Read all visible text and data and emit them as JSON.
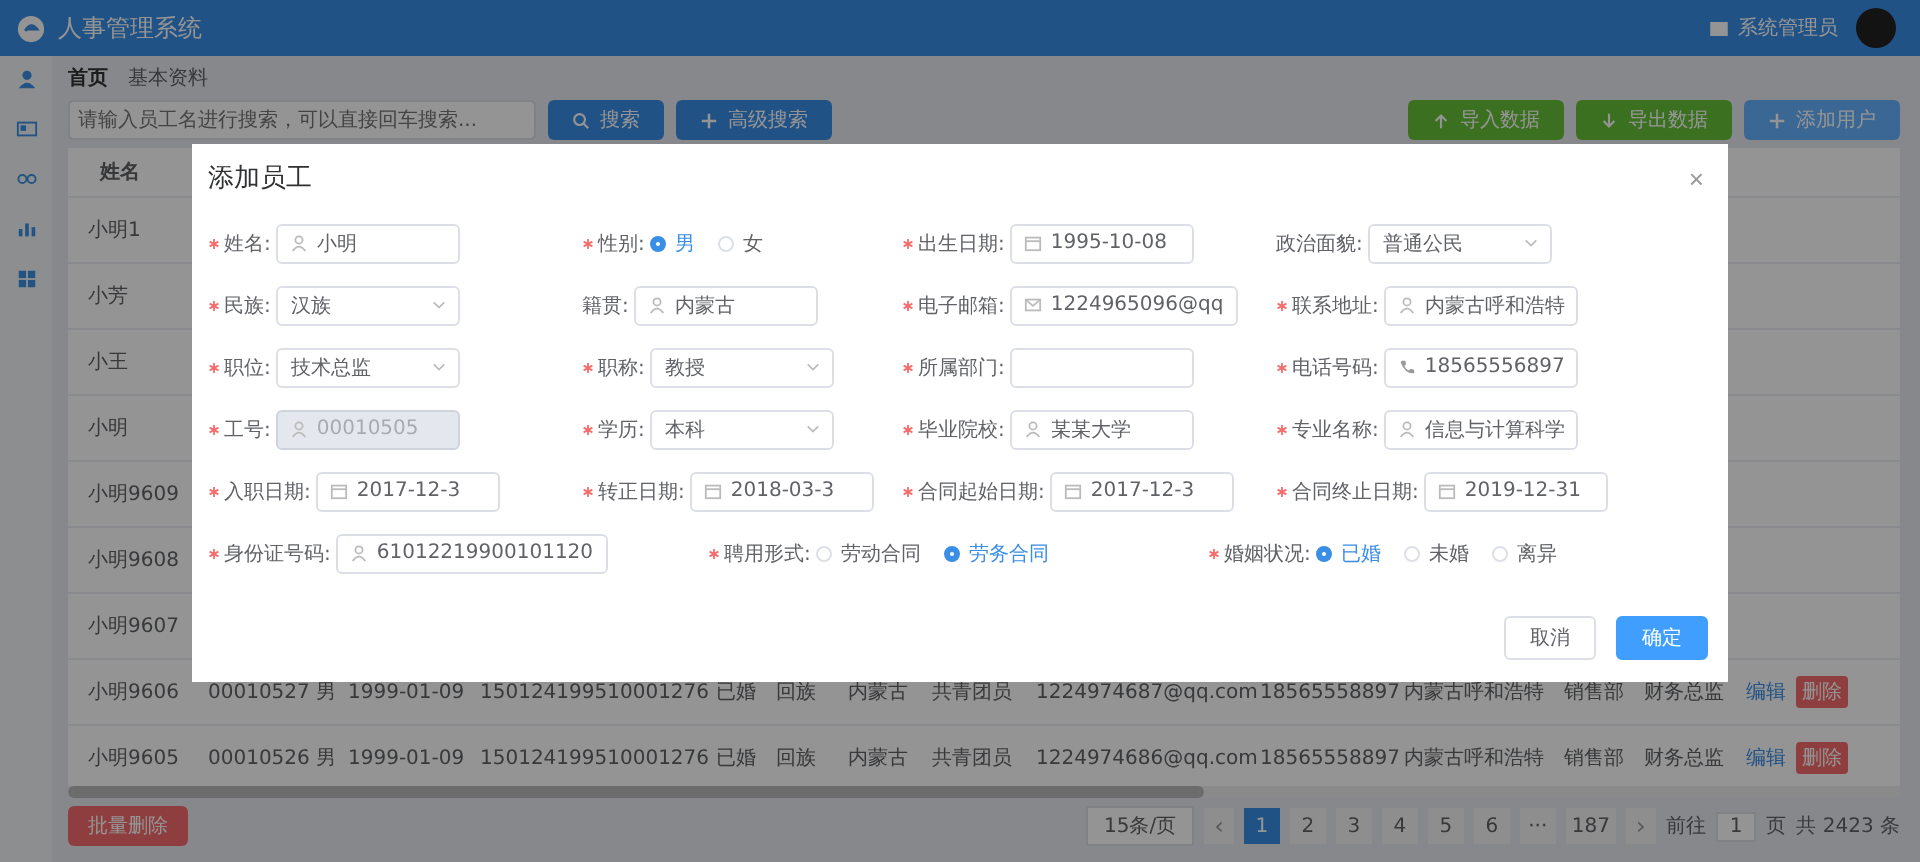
{
  "header": {
    "title": "人事管理系统",
    "user": "系统管理员"
  },
  "sidebar": {
    "items": [
      {
        "kind": "person"
      },
      {
        "kind": "card"
      },
      {
        "kind": "glasses"
      },
      {
        "kind": "chart"
      },
      {
        "kind": "windows"
      }
    ]
  },
  "breadcrumb": [
    "首页",
    "基本资料"
  ],
  "toolbar": {
    "search": {
      "placeholder": "请输入员工名进行搜索，可以直接回车搜索..."
    },
    "left_buttons": [
      {
        "label": "搜索",
        "kind": "search"
      },
      {
        "label": "高级搜索",
        "kind": "plus"
      }
    ],
    "right_buttons": [
      {
        "label": "导入数据",
        "kind": "import"
      },
      {
        "label": "导出数据",
        "kind": "export"
      },
      {
        "label": "添加用户",
        "kind": "add"
      }
    ]
  },
  "table": {
    "columns": [
      "姓名"
    ],
    "rows": [
      {
        "name": "小明1",
        "cells": []
      },
      {
        "name": "小芳",
        "cells": []
      },
      {
        "name": "小王",
        "cells": []
      },
      {
        "name": "小明",
        "cells": []
      },
      {
        "name": "小明9609",
        "cells": []
      },
      {
        "name": "小明9608",
        "cells": []
      },
      {
        "name": "小明9607",
        "cells": []
      },
      {
        "name": "小明9606",
        "cells": [
          "00010527",
          "男",
          "1999-01-09",
          "150124199510001276",
          "已婚",
          "回族",
          "内蒙古",
          "共青团员",
          "1224974687@qq.com",
          "18565558897",
          "内蒙古呼和浩特",
          "销售部",
          "财务总监"
        ],
        "actions": [
          "编辑",
          "删除"
        ]
      },
      {
        "name": "小明9605",
        "cells": [
          "00010526",
          "男",
          "1999-01-09",
          "150124199510001276",
          "已婚",
          "回族",
          "内蒙古",
          "共青团员",
          "1224974686@qq.com",
          "18565558897",
          "内蒙古呼和浩特",
          "销售部",
          "财务总监"
        ],
        "actions": [
          "编辑",
          "删除"
        ]
      }
    ]
  },
  "bulk_delete": "批量删除",
  "pagination": {
    "page_size": "15条/页",
    "prev": "‹",
    "pages": [
      {
        "label": "1",
        "selected": true
      },
      {
        "label": "2",
        "selected": false
      },
      {
        "label": "3",
        "selected": false
      },
      {
        "label": "4",
        "selected": false
      },
      {
        "label": "5",
        "selected": false
      },
      {
        "label": "6",
        "selected": false
      },
      {
        "label": "···",
        "selected": false
      },
      {
        "label": "187",
        "selected": false
      }
    ],
    "next": "›",
    "goto_label": "前往",
    "goto_value": "1",
    "goto_suffix": "页",
    "total": "共 2423 条"
  },
  "dialog": {
    "title": "添加员工",
    "close": "×",
    "rows": [
      [
        {
          "label": "姓名:",
          "kind": "text",
          "value": "小明",
          "required": true,
          "disabled": false
        },
        {
          "label": "性别:",
          "kind": "radio",
          "required": true,
          "disabled": false,
          "options": [
            {
              "label": "男",
              "selected": true
            },
            {
              "label": "女",
              "selected": false
            }
          ]
        },
        {
          "label": "出生日期:",
          "kind": "date",
          "value": "1995-10-08",
          "required": true,
          "disabled": false
        },
        {
          "label": "政治面貌:",
          "kind": "select",
          "value": "普通公民",
          "required": false,
          "disabled": false
        }
      ],
      [
        {
          "label": "民族:",
          "kind": "select",
          "value": "汉族",
          "required": true,
          "disabled": false
        },
        {
          "label": "籍贯:",
          "kind": "text",
          "value": "内蒙古",
          "required": false,
          "disabled": false
        },
        {
          "label": "电子邮箱:",
          "kind": "email",
          "value": "1224965096@qq",
          "required": true,
          "disabled": false
        },
        {
          "label": "联系地址:",
          "kind": "text",
          "value": "内蒙古呼和浩特",
          "required": true,
          "disabled": false
        }
      ],
      [
        {
          "label": "职位:",
          "kind": "select",
          "value": "技术总监",
          "required": true,
          "disabled": false
        },
        {
          "label": "职称:",
          "kind": "select",
          "value": "教授",
          "required": true,
          "disabled": false
        },
        {
          "label": "所属部门:",
          "kind": "plain",
          "required": true,
          "disabled": false
        },
        {
          "label": "电话号码:",
          "kind": "phone",
          "value": "18565556897",
          "required": true,
          "disabled": false
        }
      ],
      [
        {
          "label": "工号:",
          "kind": "text",
          "value": "00010505",
          "required": true,
          "disabled": true
        },
        {
          "label": "学历:",
          "kind": "select",
          "value": "本科",
          "required": true,
          "disabled": false
        },
        {
          "label": "毕业院校:",
          "kind": "text",
          "value": "某某大学",
          "required": true,
          "disabled": false
        },
        {
          "label": "专业名称:",
          "kind": "text",
          "value": "信息与计算科学",
          "required": true,
          "disabled": false
        }
      ],
      [
        {
          "label": "入职日期:",
          "kind": "date",
          "value": "2017-12-3",
          "required": true,
          "disabled": false
        },
        {
          "label": "转正日期:",
          "kind": "date",
          "value": "2018-03-3",
          "required": true,
          "disabled": false
        },
        {
          "label": "合同起始日期:",
          "kind": "date",
          "value": "2017-12-3",
          "required": true,
          "disabled": false
        },
        {
          "label": "合同终止日期:",
          "kind": "date",
          "value": "2019-12-31",
          "required": true,
          "disabled": false
        }
      ]
    ],
    "last_row": [
      {
        "label": "身份证号码:",
        "kind": "text",
        "value": "61012219900101120",
        "required": true,
        "disabled": false
      },
      {
        "label": "聘用形式:",
        "kind": "radio",
        "required": true,
        "disabled": false,
        "options": [
          {
            "label": "劳动合同",
            "selected": false
          },
          {
            "label": "劳务合同",
            "selected": true
          }
        ]
      },
      {
        "label": "婚姻状况:",
        "kind": "radio",
        "required": true,
        "disabled": false,
        "options": [
          {
            "label": "已婚",
            "selected": true
          },
          {
            "label": "未婚",
            "selected": false
          },
          {
            "label": "离异",
            "selected": false
          }
        ]
      }
    ],
    "buttons": [
      {
        "label": "取消",
        "kind": "default"
      },
      {
        "label": "确定",
        "kind": "primary"
      }
    ]
  }
}
